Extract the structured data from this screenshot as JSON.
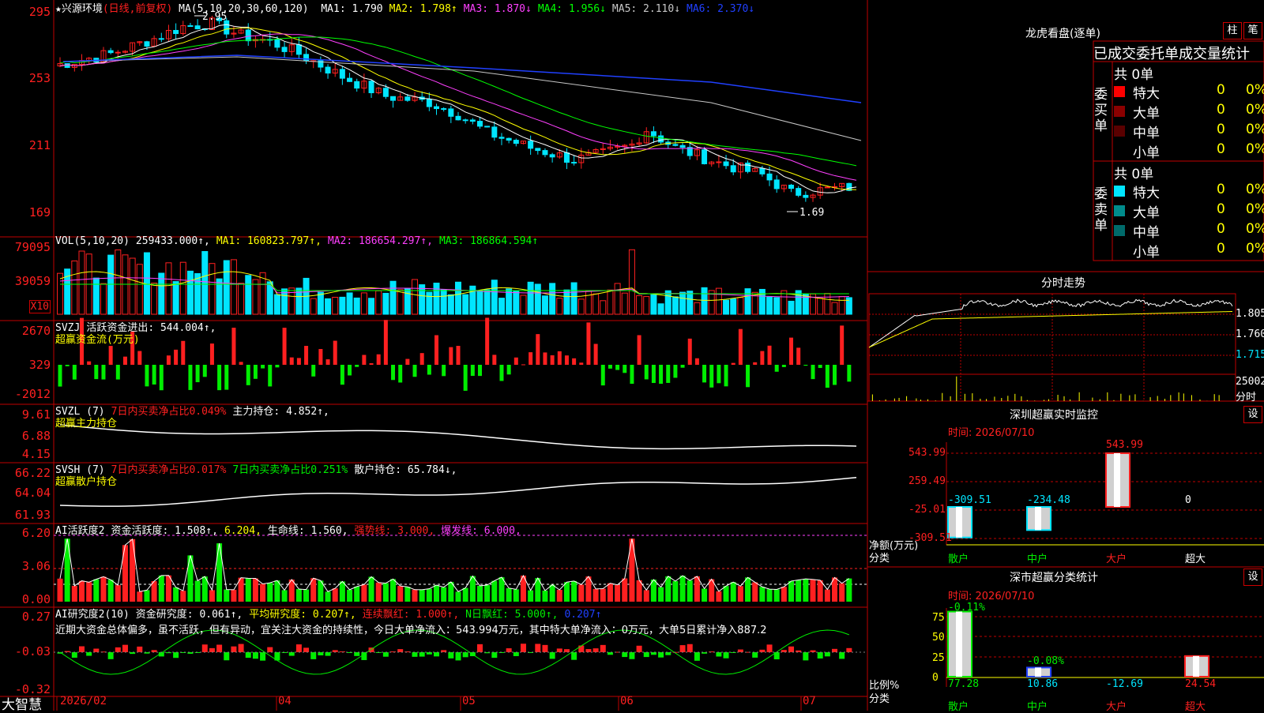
{
  "colors": {
    "up": "#ff2020",
    "down": "#00e5ff",
    "ma1": "#ffffff",
    "ma2": "#ffff00",
    "ma3": "#ff40ff",
    "ma4": "#00ff00",
    "ma5": "#c8c8c8",
    "ma6": "#2040ff",
    "frame": "#c00000",
    "green": "#00ee00",
    "yellow": "#ffff00"
  },
  "header": {
    "title": "兴源环境",
    "period": "(日线,前复权)",
    "ma_label": "MA(5,10,20,30,60,120)",
    "ma": [
      {
        "text": "MA1: 1.790",
        "color": "#ffffff"
      },
      {
        "text": "MA2: 1.798↑",
        "color": "#ffff00"
      },
      {
        "text": "MA3: 1.870↓",
        "color": "#ff40ff"
      },
      {
        "text": "MA4: 1.956↓",
        "color": "#00ff00"
      },
      {
        "text": "MA5: 2.110↓",
        "color": "#c8c8c8"
      },
      {
        "text": "MA6: 2.370↓",
        "color": "#2040ff"
      }
    ],
    "price_high": "2.95",
    "price_low": "1.69"
  },
  "axes": {
    "price": [
      "295",
      "253",
      "211",
      "169"
    ],
    "vol": [
      "79095",
      "39059",
      "X10"
    ],
    "svzj": [
      "2670",
      "329",
      "-2012"
    ],
    "svzl": [
      "9.61",
      "6.88",
      "4.15"
    ],
    "svsh": [
      "66.22",
      "64.04",
      "61.93"
    ],
    "ai": [
      "6.20",
      "3.06",
      "0.00"
    ],
    "aiyj": [
      "0.27",
      "-0.03",
      "-0.32"
    ],
    "dates": [
      "2026/02",
      "04",
      "05",
      "06",
      "07"
    ]
  },
  "panels": {
    "vol": {
      "label": "VOL(5,10,20)",
      "items": [
        {
          "text": "259433.000↑,",
          "color": "#ffffff"
        },
        {
          "text": "MA1: 160823.797↑,",
          "color": "#ffff00"
        },
        {
          "text": "MA2: 186654.297↑,",
          "color": "#ff40ff"
        },
        {
          "text": "MA3: 186864.594↑",
          "color": "#00ff00"
        }
      ]
    },
    "svzj": {
      "label": "SVZJ",
      "items": [
        {
          "text": "活跃资金进出: 544.004↑,",
          "color": "#ffffff"
        }
      ],
      "sub": "超赢资金流(万元)"
    },
    "svzl": {
      "label": "SVZL (7)",
      "items": [
        {
          "text": "7日内买卖净占比0.049%",
          "color": "#ff2020"
        },
        {
          "text": "主力持仓: 4.852↑,",
          "color": "#ffffff"
        }
      ],
      "sub": "超赢主力持仓"
    },
    "svsh": {
      "label": "SVSH (7)",
      "items": [
        {
          "text": "7日内买卖净占比0.017%",
          "color": "#ff2020"
        },
        {
          "text": "7日内买卖净占比0.251%",
          "color": "#00ee00"
        },
        {
          "text": "散户持仓: 65.784↓,",
          "color": "#ffffff"
        }
      ],
      "sub": "超赢散户持仓"
    },
    "ai": {
      "label": "AI活跃度2",
      "items": [
        {
          "text": "资金活跃度: 1.508↑,",
          "color": "#ffffff"
        },
        {
          "text": "6.204,",
          "color": "#ffff00"
        },
        {
          "text": "生命线: 1.560,",
          "color": "#ffffff"
        },
        {
          "text": "强势线: 3.000,",
          "color": "#ff2020"
        },
        {
          "text": "爆发线: 6.000,",
          "color": "#ff40ff"
        }
      ]
    },
    "aiyj": {
      "label": "AI研究度2(10)",
      "items": [
        {
          "text": "资金研究度: 0.061↑,",
          "color": "#ffffff"
        },
        {
          "text": "平均研究度: 0.207↑,",
          "color": "#ffff00"
        },
        {
          "text": "连续飘红: 1.000↑,",
          "color": "#ff2020"
        },
        {
          "text": "N日飘红: 5.000↑,",
          "color": "#00ee00"
        },
        {
          "text": "0.207↑",
          "color": "#2040ff"
        }
      ],
      "comment": "近期大资金总体偏多，虽不活跃，但有异动，宜关注大资金的持续性，今日大单净流入：543.994万元，其中特大单净流入：0万元，大单5日累计净入887.2"
    }
  },
  "brand": "大智慧",
  "dragon": {
    "title": "龙虎看盘(逐单)",
    "btn1": "柱",
    "btn2": "笔",
    "subtitle": "已成交委托单成交量统计",
    "buy": {
      "side": "委买单",
      "total": "共 0单",
      "rows": [
        {
          "name": "特大",
          "val": "0",
          "pct": "0%",
          "color": "#ff0000"
        },
        {
          "name": "大单",
          "val": "0",
          "pct": "0%",
          "color": "#8b0000"
        },
        {
          "name": "中单",
          "val": "0",
          "pct": "0%",
          "color": "#5a0000"
        },
        {
          "name": "小单",
          "val": "0",
          "pct": "0%",
          "color": ""
        }
      ]
    },
    "sell": {
      "side": "委卖单",
      "total": "共 0单",
      "rows": [
        {
          "name": "特大",
          "val": "0",
          "pct": "0%",
          "color": "#00e5ff"
        },
        {
          "name": "大单",
          "val": "0",
          "pct": "0%",
          "color": "#008b8b"
        },
        {
          "name": "中单",
          "val": "0",
          "pct": "0%",
          "color": "#006a6a"
        },
        {
          "name": "小单",
          "val": "0",
          "pct": "0%",
          "color": ""
        }
      ]
    }
  },
  "fenshi": {
    "title": "分时走势",
    "ticks": [
      "1.805",
      "1.760",
      "1.715"
    ],
    "vol_label": "25002",
    "unit": "分时"
  },
  "sz_monitor": {
    "title": "深圳超赢实时监控",
    "btn": "设",
    "time": "时间: 2026/07/10",
    "yticks": [
      "543.99",
      "259.49",
      "-25.01",
      "-309.51"
    ],
    "ylabel": "净额(万元)",
    "xlabel": "分类",
    "cats": [
      "散户",
      "中户",
      "大户",
      "超大"
    ],
    "values": [
      -309.51,
      -234.48,
      543.99,
      0
    ],
    "labels": [
      "-309.51",
      "-234.48",
      "543.99",
      "0"
    ]
  },
  "sz_class": {
    "title": "深市超赢分类统计",
    "btn": "设",
    "time": "时间: 2026/07/10",
    "yticks": [
      "75",
      "50",
      "25",
      "0"
    ],
    "ylabel": "比例%",
    "xlabel": "分类",
    "cats": [
      "散户",
      "中户",
      "大户",
      "超大"
    ],
    "bars": [
      77.28,
      10.86,
      0,
      24.54
    ],
    "values": [
      "77.28",
      "10.86",
      "-12.69",
      "24.54"
    ],
    "top_labels": [
      "-0.11%",
      "-0.08%",
      "",
      ""
    ]
  }
}
